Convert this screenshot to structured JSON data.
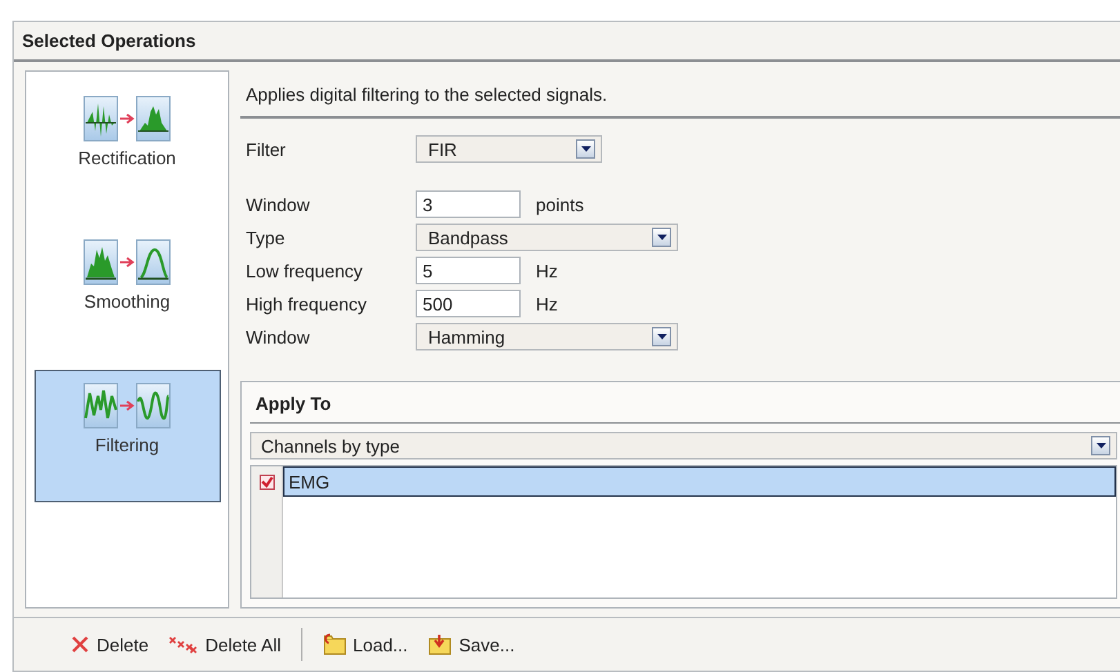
{
  "panel": {
    "title": "Selected Operations"
  },
  "operations": [
    {
      "label": "Rectification",
      "kind": "rectification",
      "selected": false
    },
    {
      "label": "Smoothing",
      "kind": "smoothing",
      "selected": false
    },
    {
      "label": "Filtering",
      "kind": "filtering",
      "selected": true
    }
  ],
  "description": "Applies digital filtering to the selected signals.",
  "filter": {
    "label": "Filter",
    "kind": "dropdown",
    "value": "FIR"
  },
  "parameters": [
    {
      "label": "Window",
      "kind": "number",
      "value": "3",
      "unit": "points"
    },
    {
      "label": "Type",
      "kind": "dropdown",
      "value": "Bandpass"
    },
    {
      "label": "Low frequency",
      "kind": "number",
      "value": "5",
      "unit": "Hz"
    },
    {
      "label": "High frequency",
      "kind": "number",
      "value": "500",
      "unit": "Hz"
    },
    {
      "label": "Window",
      "kind": "dropdown",
      "value": "Hamming"
    }
  ],
  "apply_to": {
    "title": "Apply To",
    "selector": "Channels by type",
    "items": [
      {
        "label": "EMG",
        "checked": true,
        "selected": true
      }
    ]
  },
  "toolbar": [
    {
      "label": "Delete",
      "kind": "delete"
    },
    {
      "label": "Delete All",
      "kind": "delete-all"
    },
    {
      "kind": "separator"
    },
    {
      "label": "Load...",
      "kind": "load"
    },
    {
      "label": "Save...",
      "kind": "save"
    }
  ]
}
